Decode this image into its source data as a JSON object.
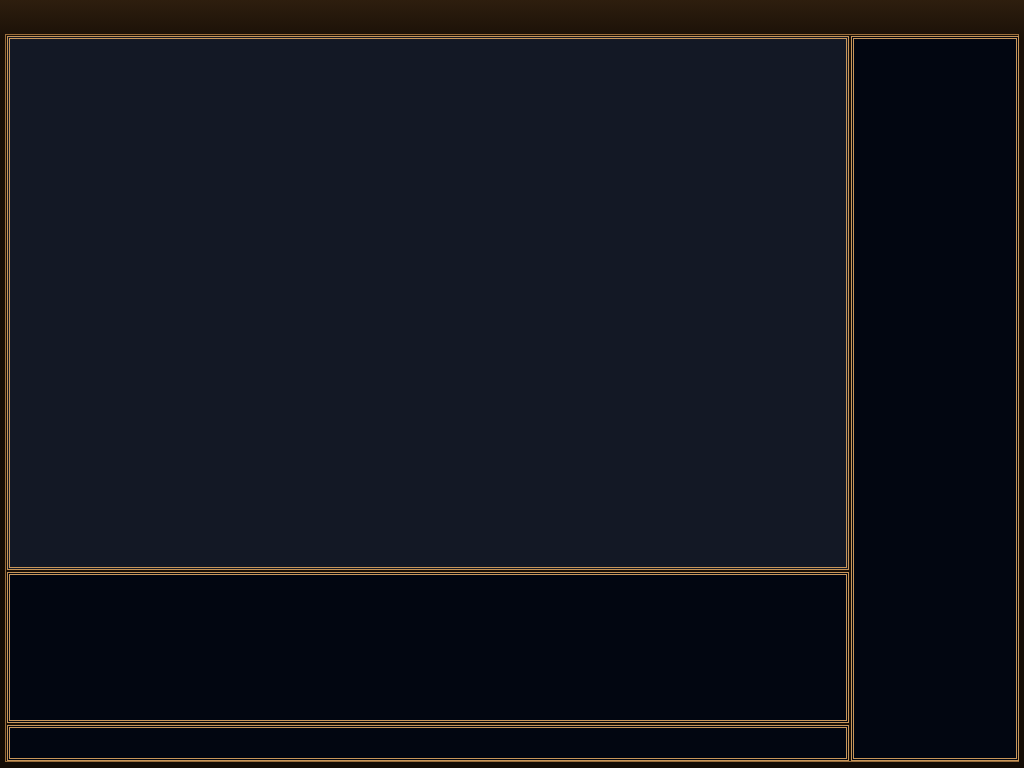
{
  "panels": [
    {
      "kind": "view"
    },
    {
      "kind": "log"
    },
    {
      "kind": "input"
    },
    {
      "kind": "side"
    }
  ]
}
